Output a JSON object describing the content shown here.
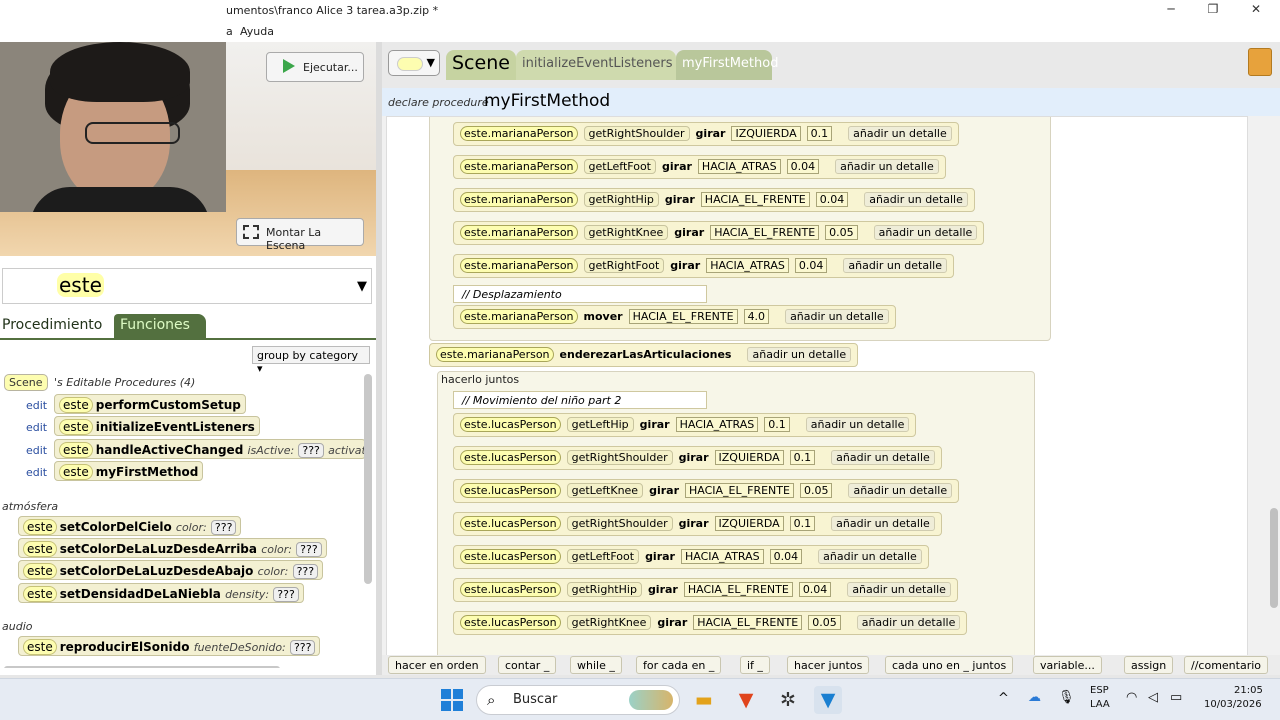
{
  "window": {
    "title": "umentos\\franco Alice 3 tarea.a3p.zip *",
    "minimize": "─",
    "maximize": "❐",
    "close": "✕"
  },
  "menu": {
    "items": [
      "a",
      "Ayuda"
    ]
  },
  "scene_panel": {
    "run_button": "Ejecutar...",
    "setup_button": "Montar La Escena"
  },
  "search": {
    "value": "este",
    "dropdown": "▼"
  },
  "palette": {
    "tabs": {
      "procedures": "Procedimiento",
      "functions": "Funciones"
    },
    "group_select": "group by category ▾",
    "scene_chip": "Scene",
    "editable_header": "'s Editable Procedures (4)",
    "edit_label": "edit",
    "editable_procs": [
      {
        "obj": "este",
        "name": "performCustomSetup",
        "param": "",
        "qq": "",
        "param2": ""
      },
      {
        "obj": "este",
        "name": "initializeEventListeners",
        "param": "",
        "qq": "",
        "param2": ""
      },
      {
        "obj": "este",
        "name": "handleActiveChanged",
        "param": "isActive:",
        "qq": "???",
        "param2": "activat"
      },
      {
        "obj": "este",
        "name": "myFirstMethod",
        "param": "",
        "qq": "",
        "param2": ""
      }
    ],
    "cat_atmosfera": "atmósfera",
    "atmos_procs": [
      {
        "obj": "este",
        "name": "setColorDelCielo",
        "param": "color:",
        "qq": "???"
      },
      {
        "obj": "este",
        "name": "setColorDeLaLuzDesdeArriba",
        "param": "color:",
        "qq": "???"
      },
      {
        "obj": "este",
        "name": "setColorDeLaLuzDesdeAbajo",
        "param": "color:",
        "qq": "???"
      },
      {
        "obj": "este",
        "name": "setDensidadDeLaNiebla",
        "param": "density:",
        "qq": "???"
      }
    ],
    "cat_audio": "audio",
    "audio_procs": [
      {
        "obj": "este",
        "name": "reproducirElSonido",
        "param": "fuenteDeSonido:",
        "qq": "???"
      }
    ]
  },
  "editor": {
    "tabs": {
      "scene": "Scene",
      "init": "initializeEventListeners",
      "my_method": "myFirstMethod"
    },
    "declare_label": "declare procedure",
    "declare_name": "myFirstMethod",
    "add_detail": "añadir un detalle",
    "part1": [
      {
        "obj": "este.marianaPerson",
        "method": "getRightShoulder",
        "verb": "girar",
        "dir": "IZQUIERDA",
        "amount": "0.1"
      },
      {
        "obj": "este.marianaPerson",
        "method": "getLeftFoot",
        "verb": "girar",
        "dir": "HACIA_ATRAS",
        "amount": "0.04"
      },
      {
        "obj": "este.marianaPerson",
        "method": "getRightHip",
        "verb": "girar",
        "dir": "HACIA_EL_FRENTE",
        "amount": "0.04"
      },
      {
        "obj": "este.marianaPerson",
        "method": "getRightKnee",
        "verb": "girar",
        "dir": "HACIA_EL_FRENTE",
        "amount": "0.05"
      },
      {
        "obj": "este.marianaPerson",
        "method": "getRightFoot",
        "verb": "girar",
        "dir": "HACIA_ATRAS",
        "amount": "0.04"
      }
    ],
    "comment1": "// Desplazamiento",
    "move": {
      "obj": "este.marianaPerson",
      "verb": "mover",
      "dir": "HACIA_EL_FRENTE",
      "amount": "4.0"
    },
    "straighten": {
      "obj": "este.marianaPerson",
      "verb": "enderezarLasArticulaciones"
    },
    "do_together_label": "hacerlo juntos",
    "comment2": "// Movimiento del niño part 2",
    "part2": [
      {
        "obj": "este.lucasPerson",
        "method": "getLeftHip",
        "verb": "girar",
        "dir": "HACIA_ATRAS",
        "amount": "0.1"
      },
      {
        "obj": "este.lucasPerson",
        "method": "getRightShoulder",
        "verb": "girar",
        "dir": "IZQUIERDA",
        "amount": "0.1"
      },
      {
        "obj": "este.lucasPerson",
        "method": "getLeftKnee",
        "verb": "girar",
        "dir": "HACIA_EL_FRENTE",
        "amount": "0.05"
      },
      {
        "obj": "este.lucasPerson",
        "method": "getRightShoulder",
        "verb": "girar",
        "dir": "IZQUIERDA",
        "amount": "0.1"
      },
      {
        "obj": "este.lucasPerson",
        "method": "getLeftFoot",
        "verb": "girar",
        "dir": "HACIA_ATRAS",
        "amount": "0.04"
      },
      {
        "obj": "este.lucasPerson",
        "method": "getRightHip",
        "verb": "girar",
        "dir": "HACIA_EL_FRENTE",
        "amount": "0.04"
      },
      {
        "obj": "este.lucasPerson",
        "method": "getRightKnee",
        "verb": "girar",
        "dir": "HACIA_EL_FRENTE",
        "amount": "0.05"
      }
    ]
  },
  "footer": {
    "items": [
      "hacer en orden",
      "contar _",
      "while _",
      "for cada en _",
      "if _",
      "hacer juntos",
      "cada uno en _ juntos",
      "variable...",
      "assign",
      "//comentario"
    ]
  },
  "taskbar": {
    "search": "Buscar",
    "lang1": "ESP",
    "lang2": "LAA",
    "time": "21:05",
    "date": "10/03/2026"
  }
}
